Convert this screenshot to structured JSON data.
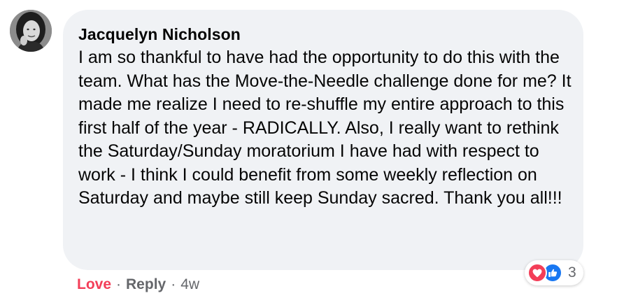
{
  "comment": {
    "author": "Jacquelyn Nicholson",
    "text": "I am so thankful to have had the opportunity to do this with the team. What has the Move-the-Needle challenge done for me? It made me realize I need to re-shuffle my entire approach to this first half of the year - RADICALLY. Also, I really want to rethink the Saturday/Sunday moratorium I have had with respect to work - I think I could benefit from some weekly reflection on Saturday and maybe still keep Sunday sacred. Thank you all!!!",
    "avatar_icon": "profile-photo"
  },
  "reactions": {
    "icons": [
      "heart-icon",
      "thumbs-up-icon"
    ],
    "count": "3",
    "love_color": "#f33e58",
    "like_color": "#1877f2"
  },
  "actions": {
    "love_label": "Love",
    "separator": "·",
    "reply_label": "Reply",
    "timestamp": "4w"
  },
  "colors": {
    "bubble_bg": "#f0f2f5",
    "text": "#050505",
    "secondary_text": "#65676b",
    "love_accent": "#f33e58"
  }
}
